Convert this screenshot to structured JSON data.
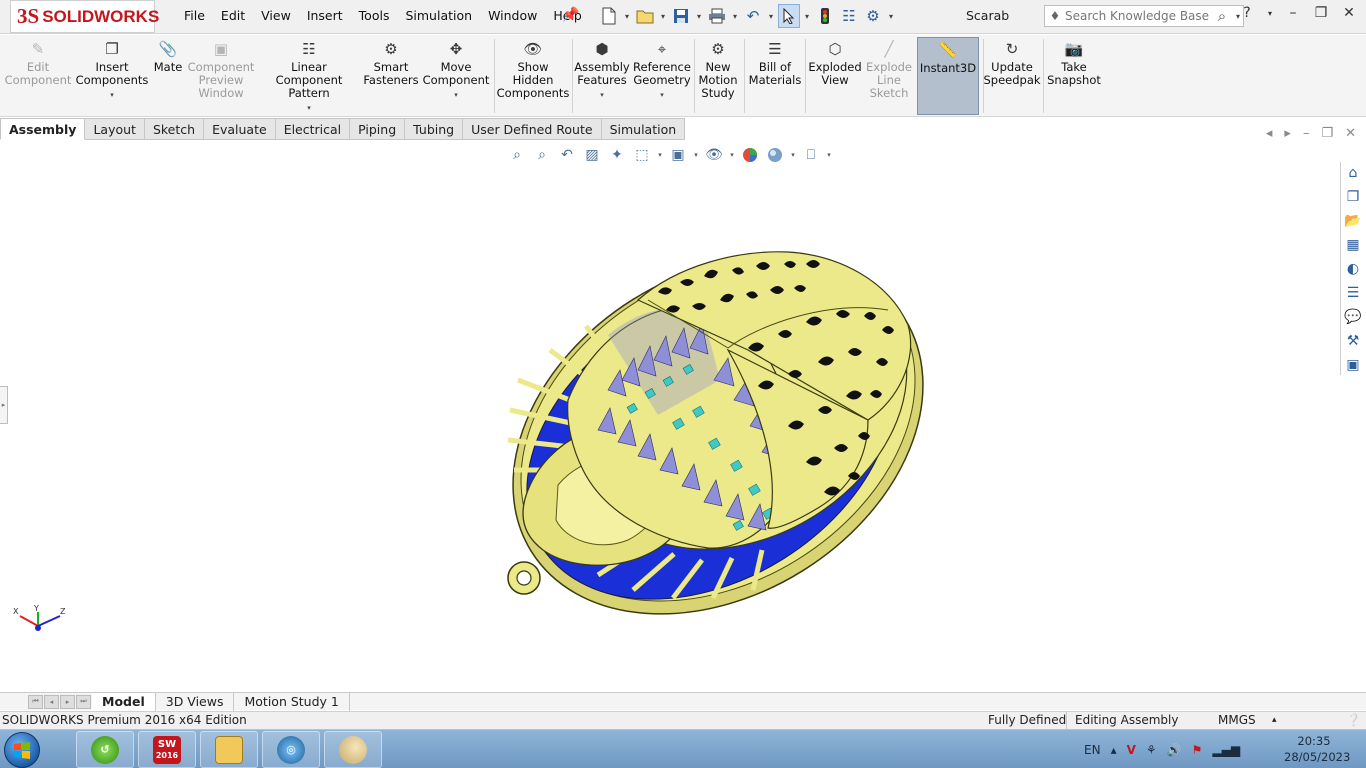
{
  "app": {
    "brand_prefix": "3S",
    "brand_name": "SOLIDWORKS",
    "document_title": "Scarab"
  },
  "menu": [
    "File",
    "Edit",
    "View",
    "Insert",
    "Tools",
    "Simulation",
    "Window",
    "Help"
  ],
  "search": {
    "placeholder": "Search Knowledge Base"
  },
  "ribbon": {
    "buttons": [
      {
        "label": "Edit Component",
        "icon": "edit-component-icon",
        "enabled": false
      },
      {
        "label": "Insert Components",
        "icon": "insert-components-icon",
        "enabled": true,
        "dropdown": true
      },
      {
        "label": "Mate",
        "icon": "mate-icon",
        "enabled": true
      },
      {
        "label": "Component Preview Window",
        "icon": "component-preview-icon",
        "enabled": false
      },
      {
        "label": "Linear Component Pattern",
        "icon": "linear-pattern-icon",
        "enabled": true,
        "dropdown": true
      },
      {
        "label": "Smart Fasteners",
        "icon": "smart-fasteners-icon",
        "enabled": true
      },
      {
        "label": "Move Component",
        "icon": "move-component-icon",
        "enabled": true,
        "dropdown": true
      },
      {
        "label": "Show Hidden Components",
        "icon": "show-hidden-icon",
        "enabled": true
      },
      {
        "label": "Assembly Features",
        "icon": "assembly-features-icon",
        "enabled": true,
        "dropdown": true
      },
      {
        "label": "Reference Geometry",
        "icon": "reference-geometry-icon",
        "enabled": true,
        "dropdown": true
      },
      {
        "label": "New Motion Study",
        "icon": "motion-study-icon",
        "enabled": true
      },
      {
        "label": "Bill of Materials",
        "icon": "bom-icon",
        "enabled": true
      },
      {
        "label": "Exploded View",
        "icon": "exploded-view-icon",
        "enabled": true
      },
      {
        "label": "Explode Line Sketch",
        "icon": "explode-line-icon",
        "enabled": false
      },
      {
        "label": "Instant3D",
        "icon": "instant3d-icon",
        "enabled": true,
        "active": true
      },
      {
        "label": "Update Speedpak",
        "icon": "speedpak-icon",
        "enabled": true
      },
      {
        "label": "Take Snapshot",
        "icon": "camera-icon",
        "enabled": true
      }
    ]
  },
  "tabs": [
    "Assembly",
    "Layout",
    "Sketch",
    "Evaluate",
    "Electrical",
    "Piping",
    "Tubing",
    "User Defined Route",
    "Simulation"
  ],
  "active_tab": "Assembly",
  "bottom_tabs": [
    "Model",
    "3D Views",
    "Motion Study 1"
  ],
  "active_bottom_tab": "Model",
  "status": {
    "edition": "SOLIDWORKS Premium 2016 x64 Edition",
    "definition": "Fully Defined",
    "mode": "Editing Assembly",
    "units": "MMGS"
  },
  "triad": {
    "x": "X",
    "y": "Y",
    "z": "Z"
  },
  "taskbar": {
    "language": "EN",
    "time": "20:35",
    "date": "28/05/2023",
    "sw_badge_top": "SW",
    "sw_badge_bottom": "2016"
  },
  "colors": {
    "brand_red": "#c4161c",
    "model_gold": "#ece98a",
    "model_blue": "#1a2fd6",
    "model_lilac": "#8f8fd8",
    "model_teal": "#3fc9c4"
  }
}
